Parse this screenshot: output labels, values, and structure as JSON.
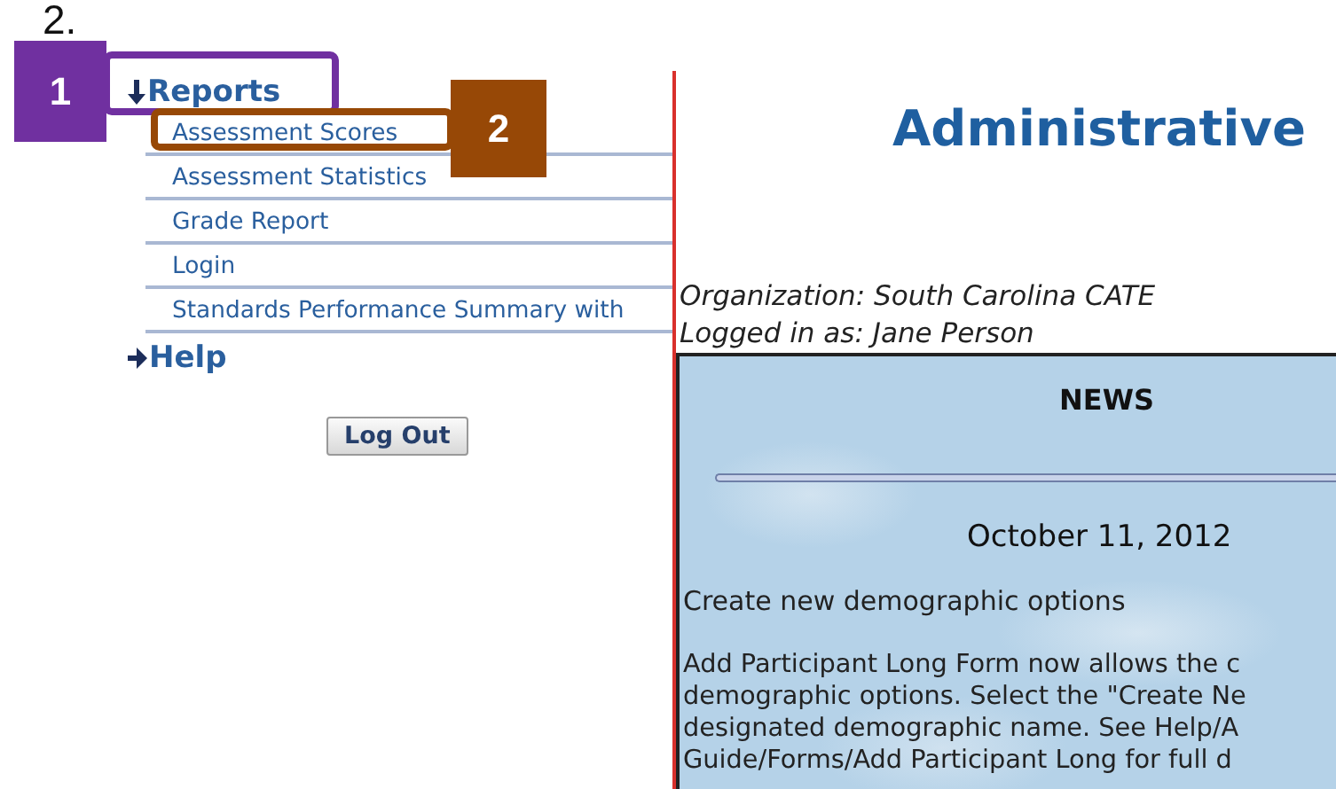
{
  "step_label": "2.",
  "callouts": [
    {
      "number": "1",
      "color": "#7030a0"
    },
    {
      "number": "2",
      "color": "#974806"
    }
  ],
  "sidebar": {
    "menus": [
      {
        "label": "Reports",
        "expanded": true,
        "children": [
          {
            "label": "Assessment Scores"
          },
          {
            "label": "Assessment Statistics"
          },
          {
            "label": "Grade Report"
          },
          {
            "label": "Login"
          },
          {
            "label": "Standards Performance Summary with"
          }
        ]
      },
      {
        "label": "Help",
        "expanded": false
      }
    ],
    "logout_button": "Log Out"
  },
  "main": {
    "title": "Administrative",
    "organization": "Organization: South Carolina CATE",
    "logged_in": "Logged in as: Jane Person",
    "news": {
      "heading": "NEWS",
      "date": "October 11, 2012",
      "headline": "Create new demographic options",
      "paragraph_lines": [
        "Add Participant Long Form now allows the c",
        "demographic options. Select the \"Create Ne",
        "designated demographic name. See Help/A",
        "Guide/Forms/Add Participant Long for full d"
      ]
    }
  }
}
